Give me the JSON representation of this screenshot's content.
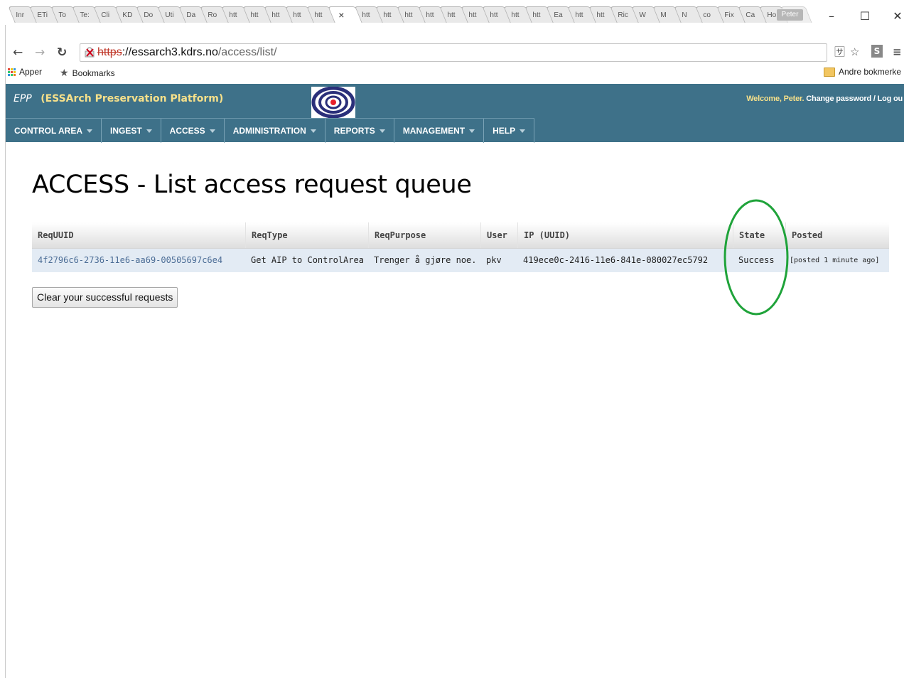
{
  "browser": {
    "tabs": [
      "Inr",
      "ETi",
      "To",
      "Te:",
      "Cli",
      "KD",
      "Do",
      "Uti",
      "Da",
      "Ro",
      "htt",
      "htt",
      "htt",
      "htt",
      "htt",
      "×",
      "htt",
      "htt",
      "htt",
      "htt",
      "htt",
      "htt",
      "htt",
      "htt",
      "htt",
      "Ea",
      "htt",
      "htt",
      "Ric",
      "W",
      "M",
      "N",
      "co",
      "Fix",
      "Ca",
      "Ho"
    ],
    "profile": "Peter",
    "address": {
      "scheme": "https",
      "host": "://essarch3.kdrs.no",
      "path": "/access/list/"
    },
    "bookmarks": {
      "apps": "Apper",
      "bookmarks": "Bookmarks",
      "other": "Andre bokmerke"
    }
  },
  "header": {
    "epp": "EPP",
    "platform": "(ESSArch Preservation Platform)",
    "welcome": "Welcome, Peter.",
    "change_password": "Change password",
    "separator": "/",
    "logout": "Log ou"
  },
  "menu": {
    "items": [
      "CONTROL AREA",
      "INGEST",
      "ACCESS",
      "ADMINISTRATION",
      "REPORTS",
      "MANAGEMENT",
      "HELP"
    ]
  },
  "page": {
    "title": "ACCESS - List access request queue",
    "columns": [
      "ReqUUID",
      "ReqType",
      "ReqPurpose",
      "User",
      "IP (UUID)",
      "State",
      "Posted"
    ],
    "rows": [
      {
        "req_uuid": "4f2796c6-2736-11e6-aa69-00505697c6e4",
        "req_type": "Get AIP to ControlArea",
        "req_purpose": "Trenger å gjøre noe.",
        "user": "pkv",
        "ip_uuid": "419ece0c-2416-11e6-841e-080027ec5792",
        "state": "Success",
        "posted": "[posted 1 minute ago]"
      }
    ],
    "clear_button": "Clear your successful requests"
  },
  "colors": {
    "header_bg": "#3e7189",
    "brand_yellow": "#f6e08a",
    "row_bg": "#e3ebf4",
    "link": "#4c6d96",
    "annotation": "#1fa33a"
  }
}
